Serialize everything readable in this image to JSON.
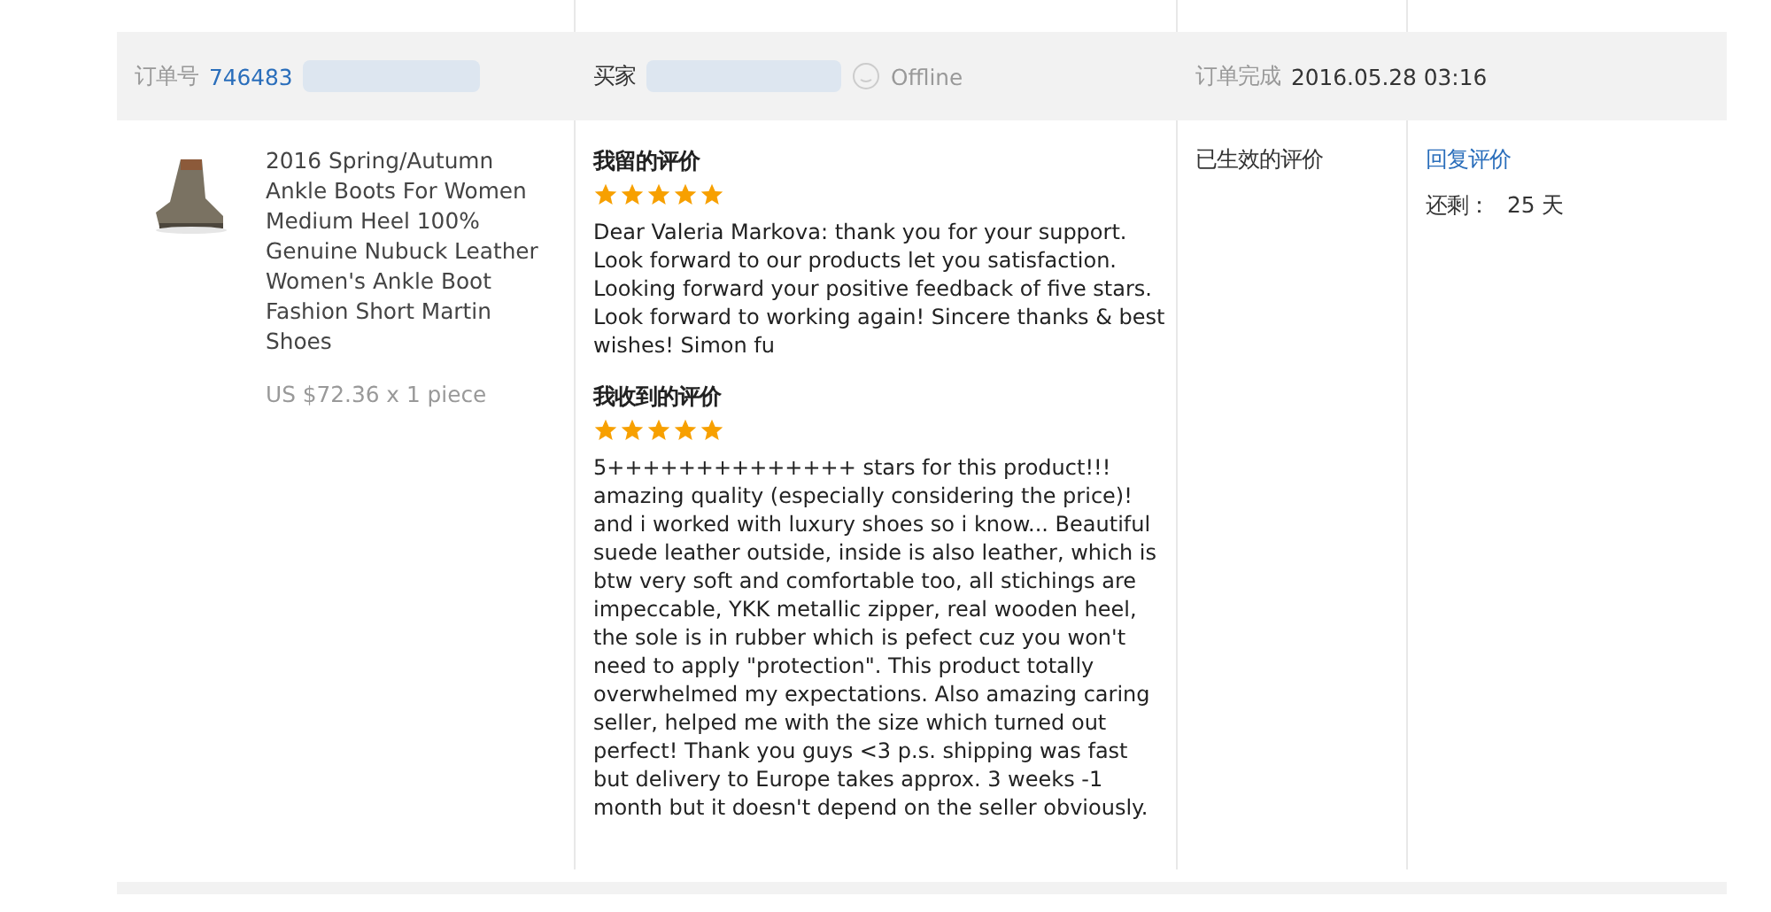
{
  "order_header": {
    "order_label": "订单号",
    "order_number": "746483",
    "buyer_label": "买家",
    "buyer_status": "Offline",
    "completed_label": "订单完成",
    "completed_time": "2016.05.28 03:16"
  },
  "product": {
    "title": "2016 Spring/Autumn Ankle Boots For Women Medium Heel 100% Genuine Nubuck Leather Women's Ankle Boot Fashion Short Martin Shoes",
    "price": "US $72.36 x 1 piece"
  },
  "reviews": [
    {
      "heading": "我留的评价",
      "stars": 5,
      "text": "Dear Valeria Markova: thank you for your support. Look forward to our products let you satisfaction. Looking forward your positive feedback of five stars. Look forward to working again! Sincere thanks & best wishes! Simon fu"
    },
    {
      "heading": "我收到的评价",
      "stars": 5,
      "text": "5++++++++++++++ stars for this product!!! amazing quality (especially considering the price)! and i worked with luxury shoes so i know... Beautiful suede leather outside, inside is also leather, which is btw very soft and comfortable too, all stichings are impeccable, YKK metallic zipper, real wooden heel, the sole is in rubber which is pefect cuz you won't need to apply \"protection\". This product totally overwhelmed my expectations. Also amazing caring seller, helped me with the size which turned out perfect! Thank you guys <3 p.s. shipping was fast but delivery to Europe takes approx. 3 weeks -1 month but it doesn't depend on the seller obviously."
    }
  ],
  "status": "已生效的评价",
  "actions": {
    "reply_link": "回复评价",
    "remaining_label": "还剩：",
    "remaining_days": "25 天"
  }
}
